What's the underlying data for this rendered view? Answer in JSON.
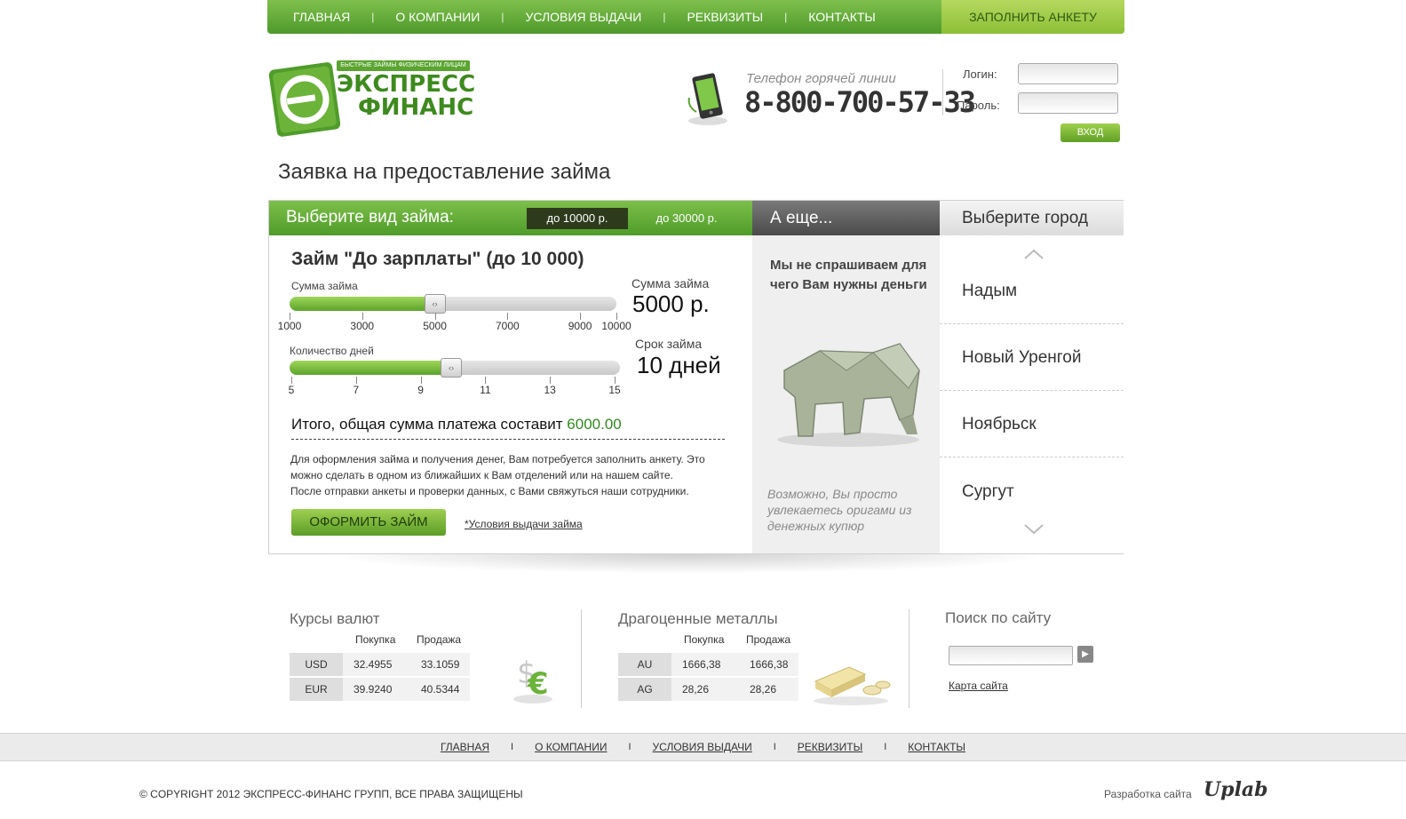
{
  "nav": {
    "items": [
      "ГЛАВНАЯ",
      "О КОМПАНИИ",
      "УСЛОВИЯ ВЫДАЧИ",
      "РЕКВИЗИТЫ",
      "КОНТАКТЫ"
    ],
    "separator": "|",
    "cta": "ЗАПОЛНИТЬ АНКЕТУ",
    "colors": {
      "green": "#5aa52f",
      "light_green": "#9fcf52"
    }
  },
  "logo": {
    "tagline": "БЫСТРЫЕ ЗАЙМЫ ФИЗИЧЕСКИМ ЛИЦАМ",
    "line1": "ЭКСПРЕСС",
    "line2": "ФИНАНС"
  },
  "hotline": {
    "caption": "Телефон горячей линии",
    "number": "8-800-700-57-33"
  },
  "login": {
    "login_label": "Логин:",
    "password_label": "Пароль:",
    "login_value": "",
    "password_value": "",
    "button": "ВХОД"
  },
  "page_title": "Заявка на предоставление займа",
  "loan": {
    "header": "Выберите вид займа:",
    "tabs": [
      "до 10000 р.",
      "до 30000 р."
    ],
    "active_tab": "до 10000 р.",
    "title": "Займ \"До зарплаты\" (до 10 000)",
    "amount": {
      "label": "Сумма займа",
      "caption": "Сумма займа",
      "value_text": "5000 р.",
      "value": 5000,
      "min": 1000,
      "max": 10000,
      "ticks": [
        "1000",
        "3000",
        "5000",
        "7000",
        "9000",
        "10000"
      ]
    },
    "days": {
      "label": "Количество дней",
      "caption": "Срок займа",
      "value_text": "10 дней",
      "value": 10,
      "min": 5,
      "max": 15,
      "ticks": [
        "5",
        "7",
        "9",
        "11",
        "13",
        "15"
      ]
    },
    "total_label": "Итого, общая сумма платежа составит",
    "total_value": "6000.00",
    "description": [
      "Для оформления займа и получения денег, Вам потребуется заполнить анкету. Это",
      "можно сделать в одном из ближайших к Вам отделений или на нашем сайте.",
      "После отправки анкеты и проверки данных, с Вами свяжуться наши сотрудники."
    ],
    "apply_button": "ОФОРМИТЬ ЗАЙМ",
    "terms_link": "*Условия выдачи займа"
  },
  "more": {
    "header": "А еще...",
    "title": "Мы не спрашиваем для чего Вам нужны деньги",
    "note": "Возможно, Вы просто увлекаетесь оригами из денежных купюр"
  },
  "cities": {
    "header": "Выберите город",
    "items": [
      "Надым",
      "Новый Уренгой",
      "Ноябрьск",
      "Сургут"
    ]
  },
  "rates": {
    "title": "Курсы валют",
    "buy": "Покупка",
    "sell": "Продажа",
    "rows": [
      {
        "code": "USD",
        "buy": "32.4955",
        "sell": "33.1059"
      },
      {
        "code": "EUR",
        "buy": "39.9240",
        "sell": "40.5344"
      }
    ]
  },
  "metals": {
    "title": "Драгоценные металлы",
    "buy": "Покупка",
    "sell": "Продажа",
    "rows": [
      {
        "code": "AU",
        "buy": "1666,38",
        "sell": "1666,38"
      },
      {
        "code": "AG",
        "buy": "28,26",
        "sell": "28,26"
      }
    ]
  },
  "search": {
    "title": "Поиск по сайту",
    "value": "",
    "sitemap": "Карта сайта"
  },
  "footer": {
    "nav": [
      "ГЛАВНАЯ",
      "О КОМПАНИИ",
      "УСЛОВИЯ ВЫДАЧИ",
      "РЕКВИЗИТЫ",
      "КОНТАКТЫ"
    ],
    "separator": "I",
    "copyright": "© COPYRIGHT 2012 ЭКСПРЕСС-ФИНАНС ГРУПП, ВСЕ ПРАВА ЗАЩИЩЕНЫ",
    "dev_label": "Разработка сайта",
    "dev_logo": "Uplab"
  }
}
